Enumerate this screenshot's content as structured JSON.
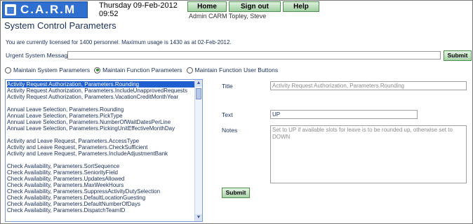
{
  "header": {
    "logo_text": "C.A.R.M",
    "date": "Thursday 09-Feb-2012",
    "time": "09:52",
    "nav": [
      "Home",
      "Sign out",
      "Help"
    ],
    "user": "Admin CARM Topley, Steve"
  },
  "page_title": "System Control Parameters",
  "license_text": "You are currently licensed for 1400 personnel. Maximum usage is 1430 as at 02-Feb-2012.",
  "urgent": {
    "label": "Urgent System Message",
    "value": "",
    "submit": "Submit"
  },
  "radios": [
    {
      "label": "Maintain System Parameters",
      "selected": false
    },
    {
      "label": "Maintain Function Parameters",
      "selected": true
    },
    {
      "label": "Maintain Function User Buttons",
      "selected": false
    }
  ],
  "parameter_list": [
    "Activity Request Authorization, Parameters.Rounding",
    "Activity Request Authorization, Parameters.IncludeUnapprovedRequests",
    "Activity Request Authorization, Parameters.VacationCreditMonthYear",
    "",
    "Annual Leave Selection, Parameters.Rounding",
    "Annual Leave Selection, Parameters.PickType",
    "Annual Leave Selection, Parameters.NumberOfWaitDatesPerLine",
    "Annual Leave Selection, Parameters.PickingUnitEffectiveMonthDay",
    "",
    "Activity and Leave Request, Parameters.AccessType",
    "Activity and Leave Request, Parameters.CheckSufficient",
    "Activity and Leave Request, Parameters.IncludeAdjustmentBank",
    "",
    "Check Availability, Parameters.SortSequence",
    "Check Availability, Parameters.SeniorityField",
    "Check Availability, Parameters.UpdatesAllowed",
    "Check Availability, Parameters.MaxWeekHours",
    "Check Availability, Parameters.SuppressActivityDutySelection",
    "Check Availability, Parameters.DefaultLocationGuesting",
    "Check Availability, Parameters.DefaultNumberOfDays",
    "Check Availability, Parameters.DispatchTeamID"
  ],
  "detail": {
    "title_label": "Title",
    "title_value": "Activity Request Authorization, Parameters.Rounding",
    "text_label": "Text",
    "text_value": "UP",
    "notes_label": "Notes",
    "notes_value": "Set to UP if available slots for leave is to be rounded up, otherwise set to DOWN",
    "submit": "Submit"
  }
}
